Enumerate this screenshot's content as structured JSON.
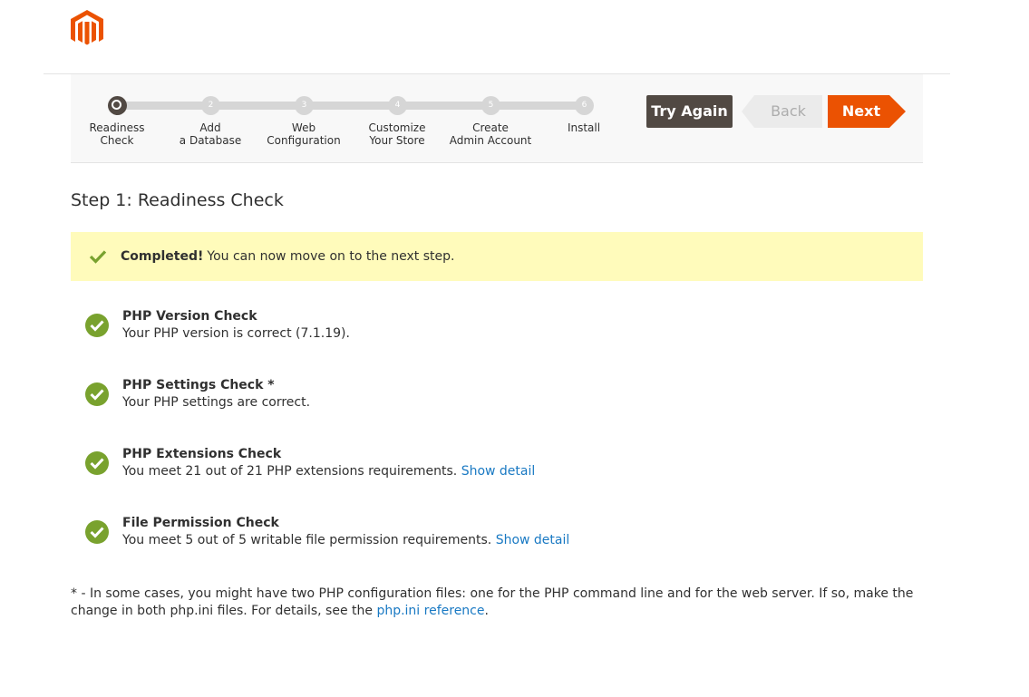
{
  "colors": {
    "brand": "#eb5202",
    "dark": "#514943",
    "success": "#79a22e",
    "notice_bg": "#fffbbb",
    "link": "#1979c3"
  },
  "logo": {
    "icon": "magento-logo"
  },
  "steps": [
    {
      "number": "",
      "line1": "Readiness",
      "line2": "Check"
    },
    {
      "number": "2",
      "line1": "Add",
      "line2": "a Database"
    },
    {
      "number": "3",
      "line1": "Web",
      "line2": "Configuration"
    },
    {
      "number": "4",
      "line1": "Customize",
      "line2": "Your Store"
    },
    {
      "number": "5",
      "line1": "Create",
      "line2": "Admin Account"
    },
    {
      "number": "6",
      "line1": "Install",
      "line2": ""
    }
  ],
  "buttons": {
    "try_again": "Try Again",
    "back": "Back",
    "next": "Next"
  },
  "page_title": "Step 1: Readiness Check",
  "notice": {
    "strong": "Completed!",
    "text": "You can now move on to the next step."
  },
  "checks": [
    {
      "title": "PHP Version Check",
      "desc": "Your PHP version is correct (7.1.19).",
      "link": ""
    },
    {
      "title": "PHP Settings Check *",
      "desc": "Your PHP settings are correct.",
      "link": ""
    },
    {
      "title": "PHP Extensions Check",
      "desc": "You meet 21 out of 21 PHP extensions requirements.",
      "link": "Show detail"
    },
    {
      "title": "File Permission Check",
      "desc": "You meet 5 out of 5 writable file permission requirements.",
      "link": "Show detail"
    }
  ],
  "footnote": {
    "text": "* - In some cases, you might have two PHP configuration files: one for the PHP command line and for the web server. If so, make the change in both php.ini files. For details, see the",
    "link": "php.ini reference",
    "end": "."
  }
}
